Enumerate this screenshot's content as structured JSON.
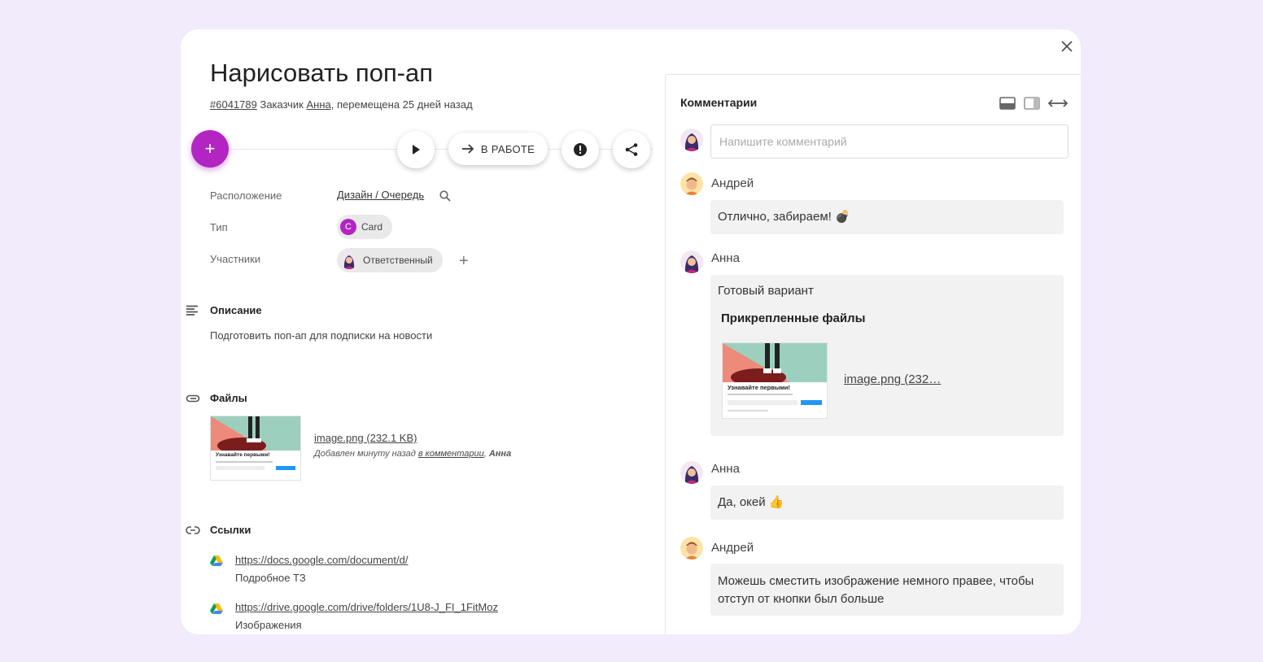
{
  "task": {
    "title": "Нарисовать поп-ап",
    "id": "#6041789",
    "customer_label": "Заказчик",
    "customer_name": "Анна",
    "moved_text": ", перемещена 25 дней назад"
  },
  "toolbar": {
    "add_label": "+",
    "status_label": "В РАБОТЕ"
  },
  "properties": {
    "location_label": "Расположение",
    "location_value": "Дизайн / Очередь",
    "type_label": "Тип",
    "type_badge_letter": "C",
    "type_value": "Card",
    "members_label": "Участники",
    "member_role": "Ответственный"
  },
  "description": {
    "title": "Описание",
    "text": "Подготовить поп-ап для подписки на новости"
  },
  "files": {
    "title": "Файлы",
    "file_name": "image.png (232.1 KB)",
    "added_prefix": "Добавлен минуту назад",
    "added_link": "в комментарии",
    "added_author": "Анна",
    "thumb_heading": "Узнавайте первыми!"
  },
  "links": {
    "title": "Ссылки",
    "items": [
      {
        "url": "https://docs.google.com/document/d/",
        "desc": "Подробное ТЗ"
      },
      {
        "url": "https://drive.google.com/drive/folders/1U8-J_FI_1FitMoz",
        "desc": "Изображения"
      }
    ]
  },
  "comments": {
    "title": "Комментарии",
    "placeholder": "Напишите комментарий",
    "items": [
      {
        "author": "Андрей",
        "text": "Отлично, забираем! 💣"
      },
      {
        "author": "Анна",
        "text": "Готовый вариант",
        "attach_title": "Прикрепленные файлы",
        "attach_link": "image.png (232…"
      },
      {
        "author": "Анна",
        "text": "Да, окей 👍"
      },
      {
        "author": "Андрей",
        "text": "Можешь сместить изображение немного правее, чтобы отступ от кнопки был больше"
      }
    ]
  },
  "colors": {
    "background": "#f1ebfb",
    "accent": "#b225c2",
    "bubble": "#f2f2f2"
  }
}
